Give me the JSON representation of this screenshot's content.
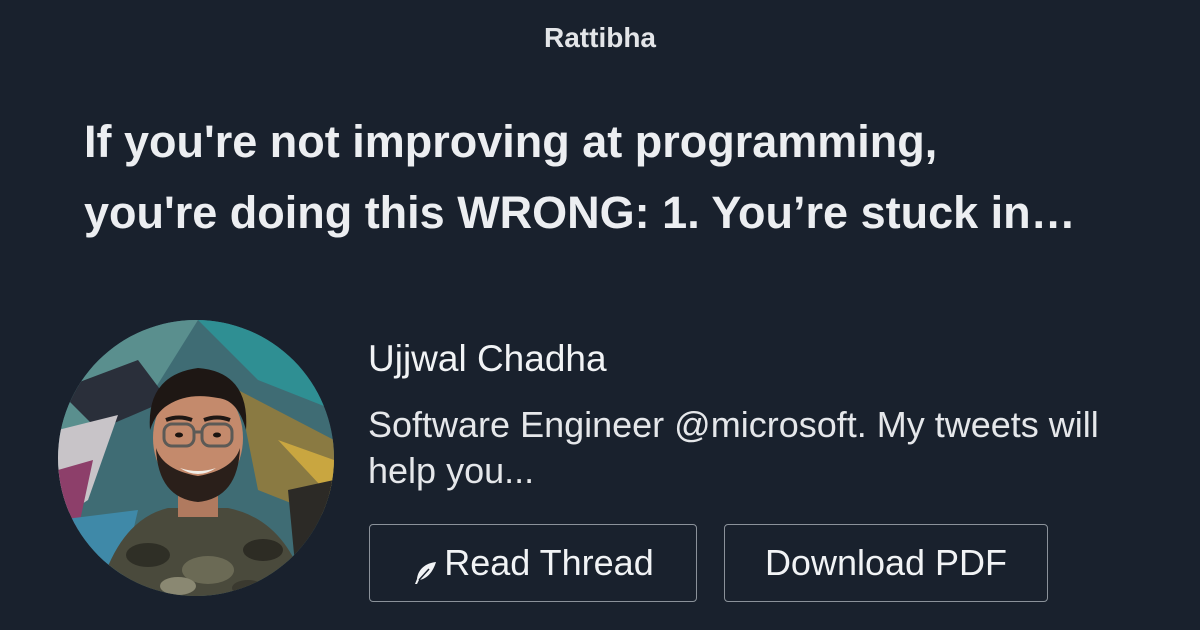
{
  "brand": {
    "name": "Rattibha"
  },
  "headline": {
    "line1": "If you're not improving at programming,",
    "line2": "you're doing this WRONG: 1. You’re stuck in…"
  },
  "author": {
    "name": "Ujjwal Chadha",
    "bio_line1": "Software Engineer @microsoft. My tweets will",
    "bio_line2": "help you..."
  },
  "buttons": {
    "read_label": "Read Thread",
    "read_icon": "feather-icon",
    "pdf_label": "Download PDF"
  },
  "colors": {
    "background": "#19212d",
    "text": "#f1f3f5",
    "button_border": "#8b929a"
  }
}
